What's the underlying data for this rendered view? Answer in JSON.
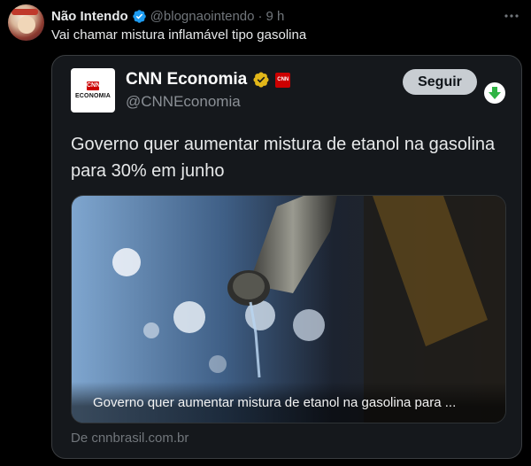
{
  "tweet": {
    "author_name": "Não Intendo",
    "author_handle": "@blognaointendo",
    "separator": "·",
    "time": "9 h",
    "text": "Vai chamar mistura inflamável tipo gasolina"
  },
  "quoted": {
    "logo_small_text": "CNN",
    "logo_text": "ECONOMIA",
    "name": "CNN Economia",
    "badge_text": "CNN",
    "handle": "@CNNEconomia",
    "follow_label": "Seguir",
    "headline": "Governo quer aumentar mistura de etanol na gasolina para 30% em junho",
    "card_caption": "Governo quer aumentar mistura de etanol na gasolina para ...",
    "source": "De cnnbrasil.com.br"
  },
  "icons": {
    "verified": "blue-verified-icon",
    "gold_verified": "gold-verified-icon",
    "more": "more-options-icon",
    "download": "green-down-arrow-icon"
  },
  "colors": {
    "background": "#000000",
    "verified_blue": "#1d9bf0",
    "gold": "#e2b719",
    "cnn_red": "#cc0000",
    "follow_button": "#c8cdd2",
    "green_arrow": "#2fb344"
  }
}
